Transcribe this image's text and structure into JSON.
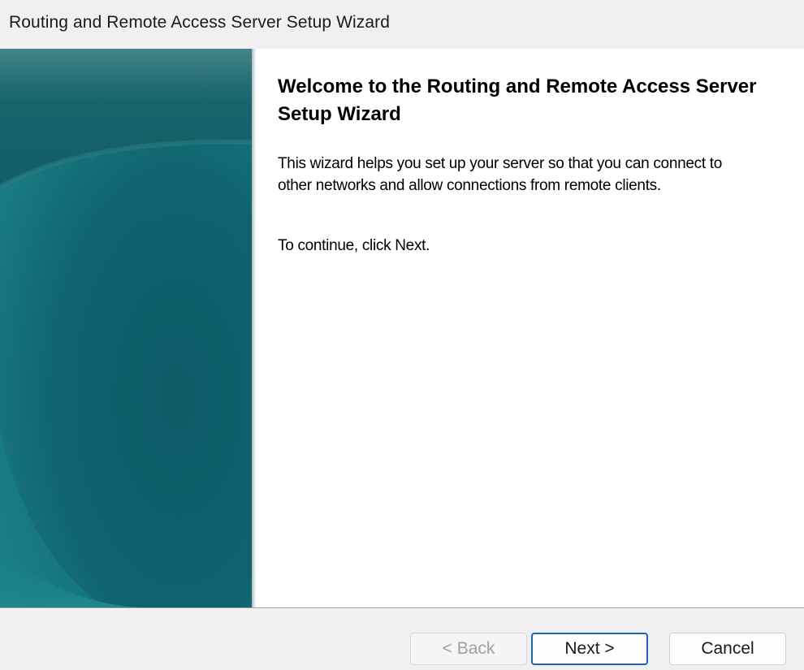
{
  "window": {
    "title": "Routing and Remote Access Server Setup Wizard"
  },
  "content": {
    "heading": "Welcome to the Routing and Remote Access Server Setup Wizard",
    "description": "This wizard helps you set up your server so that you can connect to other networks and allow connections from remote clients.",
    "instruction": "To continue, click Next."
  },
  "buttons": {
    "back_label": "< Back",
    "next_label": "Next >",
    "cancel_label": "Cancel"
  },
  "colors": {
    "sidebar_teal": "#115a62",
    "focus_border": "#1f62b8"
  }
}
